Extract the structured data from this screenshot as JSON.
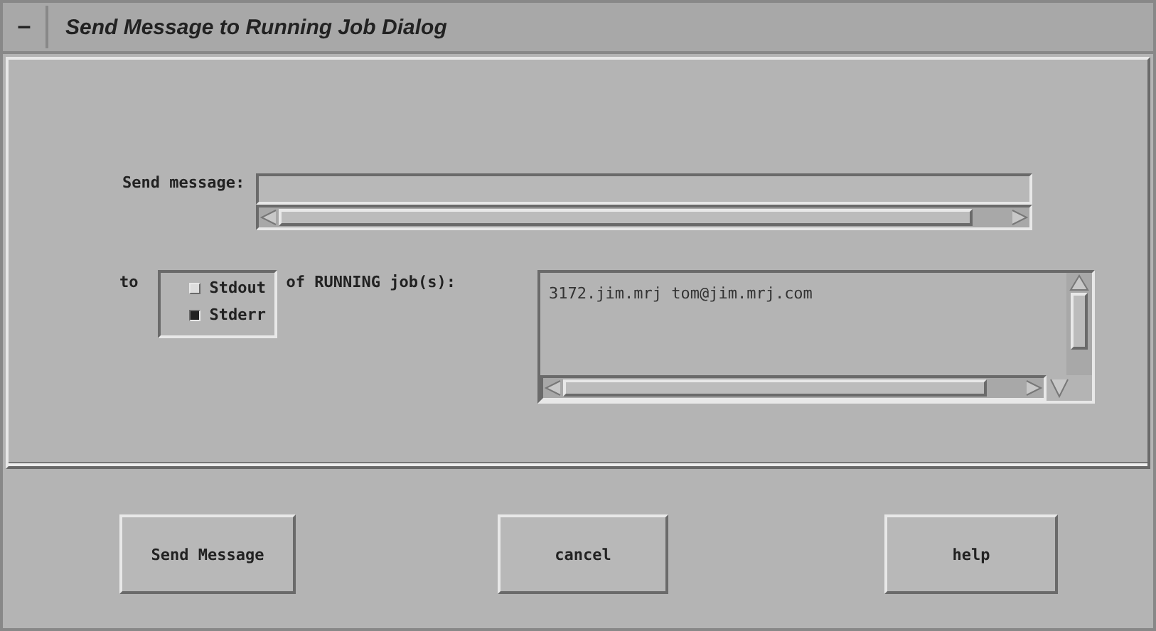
{
  "window": {
    "title": "Send Message to Running Job Dialog",
    "menu_glyph": "—"
  },
  "message": {
    "label": "Send message:"
  },
  "target": {
    "label": "to",
    "suffix": "of RUNNING job(s):",
    "options": [
      {
        "label": "Stdout",
        "selected": false
      },
      {
        "label": "Stderr",
        "selected": true
      }
    ]
  },
  "jobs": {
    "items": [
      "3172.jim.mrj tom@jim.mrj.com"
    ]
  },
  "buttons": [
    {
      "label": "Send Message"
    },
    {
      "label": "cancel"
    },
    {
      "label": "help"
    }
  ]
}
